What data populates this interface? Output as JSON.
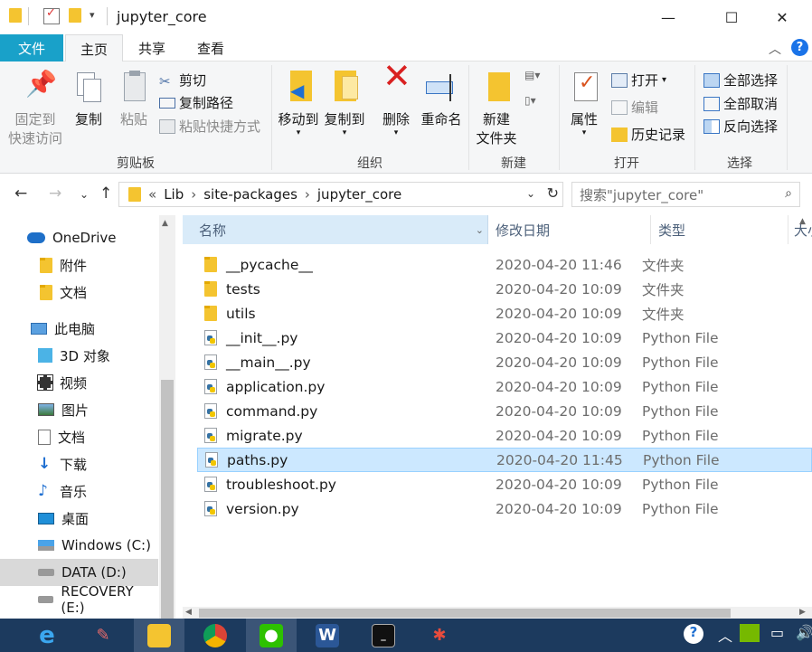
{
  "window": {
    "title": "jupyter_core",
    "controls": {
      "minimize": "—",
      "maximize": "☐",
      "close": "✕"
    }
  },
  "ribbon_tabs": [
    "文件",
    "主页",
    "共享",
    "查看"
  ],
  "ribbon": {
    "clipboard": {
      "group_label": "剪贴板",
      "pin_label_1": "固定到",
      "pin_label_2": "快速访问",
      "copy": "复制",
      "paste": "粘贴",
      "cut": "剪切",
      "copy_path": "复制路径",
      "paste_shortcut": "粘贴快捷方式"
    },
    "organize": {
      "group_label": "组织",
      "move_to": "移动到",
      "copy_to": "复制到",
      "delete": "删除",
      "rename": "重命名"
    },
    "new": {
      "group_label": "新建",
      "new_folder_1": "新建",
      "new_folder_2": "文件夹"
    },
    "open": {
      "group_label": "打开",
      "properties": "属性",
      "open": "打开",
      "edit": "编辑",
      "history": "历史记录"
    },
    "select": {
      "group_label": "选择",
      "select_all": "全部选择",
      "select_none": "全部取消",
      "invert": "反向选择"
    }
  },
  "address": {
    "crumbs": [
      "«",
      "Lib",
      "site-packages",
      "jupyter_core"
    ],
    "search_placeholder": "搜索\"jupyter_core\""
  },
  "sidebar": {
    "items": [
      {
        "label": "OneDrive",
        "icon": "cloud-icon"
      },
      {
        "label": "附件",
        "icon": "folder-icon"
      },
      {
        "label": "文档",
        "icon": "folder-icon"
      },
      {
        "label": "此电脑",
        "icon": "computer-icon"
      },
      {
        "label": "3D 对象",
        "icon": "cube-icon"
      },
      {
        "label": "视频",
        "icon": "video-icon"
      },
      {
        "label": "图片",
        "icon": "picture-icon"
      },
      {
        "label": "文档",
        "icon": "document-icon"
      },
      {
        "label": "下载",
        "icon": "download-icon"
      },
      {
        "label": "音乐",
        "icon": "music-icon"
      },
      {
        "label": "桌面",
        "icon": "desktop-icon"
      },
      {
        "label": "Windows (C:)",
        "icon": "windows-drive-icon"
      },
      {
        "label": "DATA (D:)",
        "icon": "drive-icon"
      },
      {
        "label": "RECOVERY (E:)",
        "icon": "drive-icon"
      }
    ]
  },
  "columns": {
    "name": "名称",
    "date": "修改日期",
    "type": "类型",
    "size": "大小"
  },
  "files": [
    {
      "name": "__pycache__",
      "date": "2020-04-20 11:46",
      "type": "文件夹",
      "kind": "folder"
    },
    {
      "name": "tests",
      "date": "2020-04-20 10:09",
      "type": "文件夹",
      "kind": "folder"
    },
    {
      "name": "utils",
      "date": "2020-04-20 10:09",
      "type": "文件夹",
      "kind": "folder"
    },
    {
      "name": "__init__.py",
      "date": "2020-04-20 10:09",
      "type": "Python File",
      "kind": "py"
    },
    {
      "name": "__main__.py",
      "date": "2020-04-20 10:09",
      "type": "Python File",
      "kind": "py"
    },
    {
      "name": "application.py",
      "date": "2020-04-20 10:09",
      "type": "Python File",
      "kind": "py"
    },
    {
      "name": "command.py",
      "date": "2020-04-20 10:09",
      "type": "Python File",
      "kind": "py"
    },
    {
      "name": "migrate.py",
      "date": "2020-04-20 10:09",
      "type": "Python File",
      "kind": "py"
    },
    {
      "name": "paths.py",
      "date": "2020-04-20 11:45",
      "type": "Python File",
      "kind": "py",
      "selected": true
    },
    {
      "name": "troubleshoot.py",
      "date": "2020-04-20 10:09",
      "type": "Python File",
      "kind": "py"
    },
    {
      "name": "version.py",
      "date": "2020-04-20 10:09",
      "type": "Python File",
      "kind": "py"
    }
  ],
  "taskbar": [
    "edge-icon",
    "paint-icon",
    "file-explorer-icon",
    "chrome-icon",
    "wechat-icon",
    "word-icon",
    "terminal-icon",
    "network-icon"
  ],
  "colors": {
    "accent": "#19a1c9",
    "selection": "#cce8ff",
    "taskbar": "#1c3a5e"
  }
}
